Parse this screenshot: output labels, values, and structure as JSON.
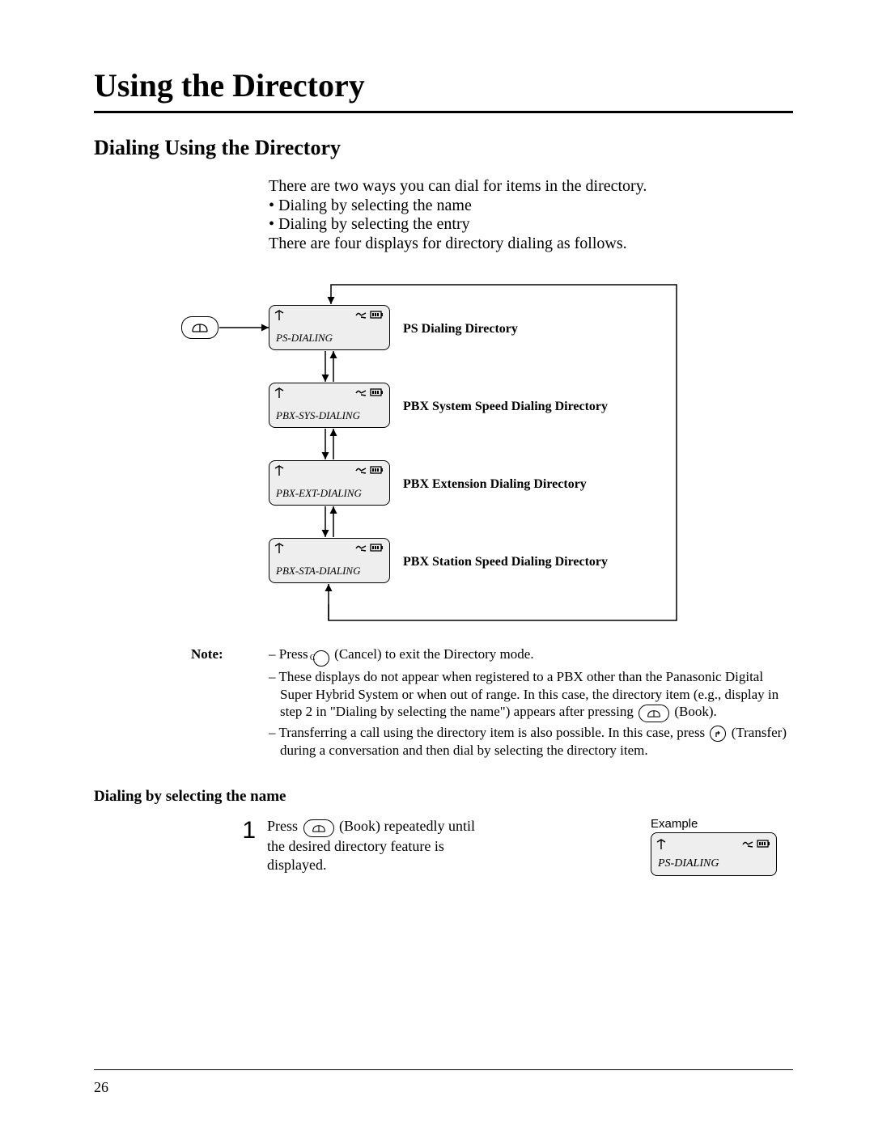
{
  "title": "Using the Directory",
  "section_title": "Dialing Using the Directory",
  "intro1": "There are two ways you can dial for items in the directory.",
  "bullet1": "Dialing by selecting the name",
  "bullet2": "Dialing by selecting the entry",
  "intro2": "There are four displays for directory dialing as follows.",
  "displays": [
    {
      "label": "PS-DIALING",
      "caption": "PS Dialing Directory"
    },
    {
      "label": "PBX-SYS-DIALING",
      "caption": "PBX System Speed Dialing Directory"
    },
    {
      "label": "PBX-EXT-DIALING",
      "caption": "PBX Extension Dialing Directory"
    },
    {
      "label": "PBX-STA-DIALING",
      "caption": "PBX Station Speed Dialing Directory"
    }
  ],
  "note_head": "Note:",
  "note1a": "– Press ",
  "note1b": " (Cancel) to exit the Directory mode.",
  "note2a": "– These displays do not appear when registered to a PBX other than the Panasonic Digital Super Hybrid System or when out of range.  In this case, the directory item (e.g., display in step 2 in \"Dialing by selecting the name\") appears after pressing ",
  "note2b": " (Book).",
  "note3a": "– Transferring a call using the directory item is also possible.  In this case, press ",
  "note3b": " (Transfer) during a conversation and then dial by selecting the directory item.",
  "sub_title": "Dialing by selecting the name",
  "step1": {
    "num": "1",
    "pre": "Press ",
    "post": " (Book) repeatedly until the desired directory feature is displayed."
  },
  "example_label": "Example",
  "example_text": "PS-DIALING",
  "cancel_letter": "C",
  "page_number": "26"
}
